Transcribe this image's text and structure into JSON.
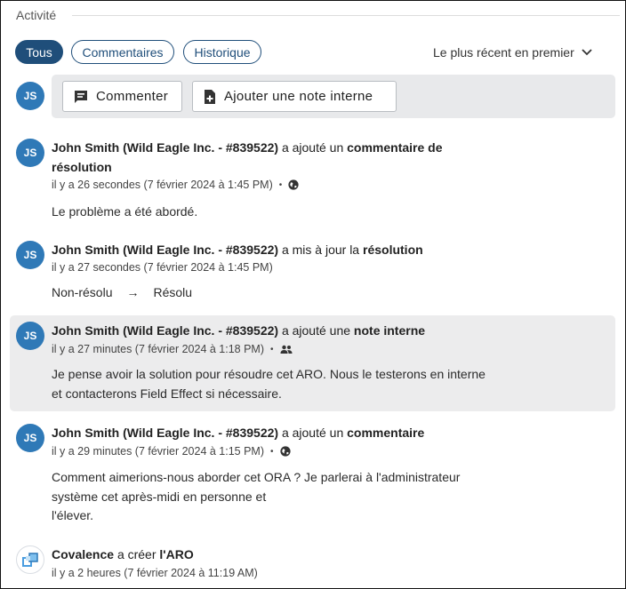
{
  "header": {
    "title": "Activité"
  },
  "filters": {
    "all": "Tous",
    "comments": "Commentaires",
    "history": "Historique"
  },
  "sort": {
    "label": "Le plus récent en premier",
    "icon": "chevron-down-icon"
  },
  "composer": {
    "avatar": "JS",
    "comment_label": "Commenter",
    "comment_icon": "comment-icon",
    "note_label": "Ajouter une note interne",
    "note_icon": "note-add-icon"
  },
  "activities": [
    {
      "avatar": "JS",
      "actor": "John Smith (Wild Eagle Inc. - #839522)",
      "action": "a ajouté un",
      "target_line1": "commentaire de",
      "target_line2": "résolution",
      "time": "il y a 26 secondes (7 février 2024 à 1:45 PM)",
      "visibility_icon": "globe-icon",
      "body": "Le problème a été abordé."
    },
    {
      "avatar": "JS",
      "actor": "John Smith (Wild Eagle Inc. - #839522)",
      "action": "a mis à jour la",
      "target": "résolution",
      "time": "il y a 27 secondes (7 février 2024 à 1:45 PM)",
      "from": "Non-résolu",
      "arrow": "→",
      "to": "Résolu"
    },
    {
      "avatar": "JS",
      "actor": "John Smith (Wild Eagle Inc. - #839522)",
      "action": "a ajouté une",
      "target": "note interne",
      "time": "il y a 27 minutes (7 février 2024 à 1:18 PM)",
      "visibility_icon": "people-icon",
      "body_line1": "Je pense avoir la solution pour résoudre cet ARO. Nous le testerons en interne",
      "body_line2": "et contacterons Field Effect si nécessaire."
    },
    {
      "avatar": "JS",
      "actor": "John Smith (Wild Eagle Inc. - #839522)",
      "action": "a ajouté un",
      "target": "commentaire",
      "time": "il y a 29 minutes (7 février 2024 à 1:15 PM)",
      "visibility_icon": "globe-icon",
      "body_line1": "Comment aimerions-nous aborder cet ORA ? Je parlerai à l'administrateur",
      "body_line2": "système cet après-midi en personne et",
      "body_line3": "l'élever."
    },
    {
      "avatar_icon": "covalence-logo-icon",
      "actor": "Covalence",
      "action": "a créer",
      "target": "l'ARO",
      "time": "il y a 2 heures (7 février 2024 à 11:19 AM)"
    }
  ],
  "colors": {
    "accent": "#1f4e7a",
    "avatar": "#2f79b7",
    "highlight_bg": "#ececed",
    "composer_bg": "#e8e9eb"
  }
}
